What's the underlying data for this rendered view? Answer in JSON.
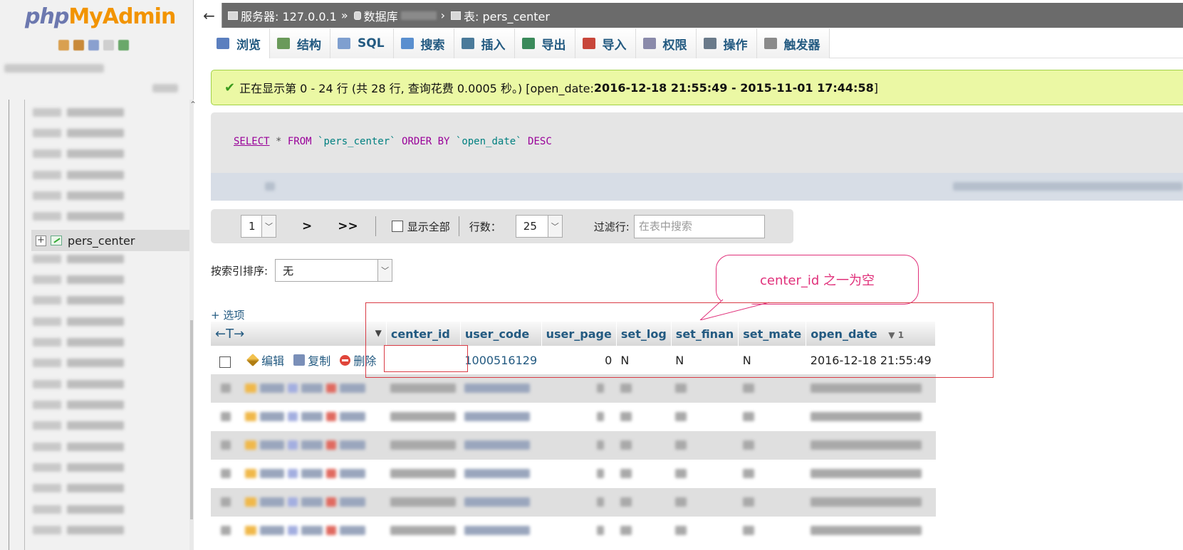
{
  "logo": {
    "php": "php",
    "myadmin": "MyAdmin"
  },
  "breadcrumb": {
    "back": "←",
    "server_label": "服务器: 127.0.0.1",
    "sep": "»",
    "db_label": "数据库",
    "table_label": "表: pers_center"
  },
  "nav": {
    "active_table": "pers_center"
  },
  "tabs": [
    {
      "label": "浏览",
      "icon": "browse-icon",
      "color": "#5b7fbf"
    },
    {
      "label": "结构",
      "icon": "structure-icon",
      "color": "#6a9a5a"
    },
    {
      "label": "SQL",
      "icon": "sql-icon",
      "color": "#7f9fcf"
    },
    {
      "label": "搜索",
      "icon": "search-icon",
      "color": "#5a8fcf"
    },
    {
      "label": "插入",
      "icon": "insert-icon",
      "color": "#4a7a9a"
    },
    {
      "label": "导出",
      "icon": "export-icon",
      "color": "#3a8a5a"
    },
    {
      "label": "导入",
      "icon": "import-icon",
      "color": "#c8463a"
    },
    {
      "label": "权限",
      "icon": "privileges-icon",
      "color": "#8a8aaa"
    },
    {
      "label": "操作",
      "icon": "operations-icon",
      "color": "#6a7a8a"
    },
    {
      "label": "触发器",
      "icon": "triggers-icon",
      "color": "#8a8a8a"
    }
  ],
  "message": {
    "text": "正在显示第 0 - 24 行 (共 28 行, 查询花费 0.0005 秒。) [open_date: ",
    "range": "2016-12-18 21:55:49 - 2015-11-01 17:44:58",
    "end": "]"
  },
  "sql": {
    "select": "SELECT",
    "star": " * ",
    "from": "FROM",
    "table": " `pers_center` ",
    "orderby": "ORDER BY",
    "column": " `open_date` ",
    "desc": "DESC"
  },
  "pager": {
    "page": "1",
    "next": ">",
    "last": ">>",
    "show_all": "显示全部",
    "rows_label": "行数：",
    "rows_value": "25",
    "filter_label": "过滤行:",
    "filter_placeholder": "在表中搜索"
  },
  "sort": {
    "label": "按索引排序:",
    "value": "无"
  },
  "callout": {
    "text": "center_id 之一为空"
  },
  "options_label": "+ 选项",
  "table": {
    "resize_icon": "←T→",
    "columns": [
      "center_id",
      "user_code",
      "user_page",
      "set_log",
      "set_finan",
      "set_mate",
      "open_date"
    ],
    "sort_indicator": "▼ 1",
    "actions": {
      "edit": "编辑",
      "copy": "复制",
      "delete": "删除"
    },
    "first_row": {
      "center_id": "",
      "user_code": "1000516129",
      "user_page": "0",
      "set_log": "N",
      "set_finan": "N",
      "set_mate": "N",
      "open_date": "2016-12-18 21:55:49"
    }
  }
}
